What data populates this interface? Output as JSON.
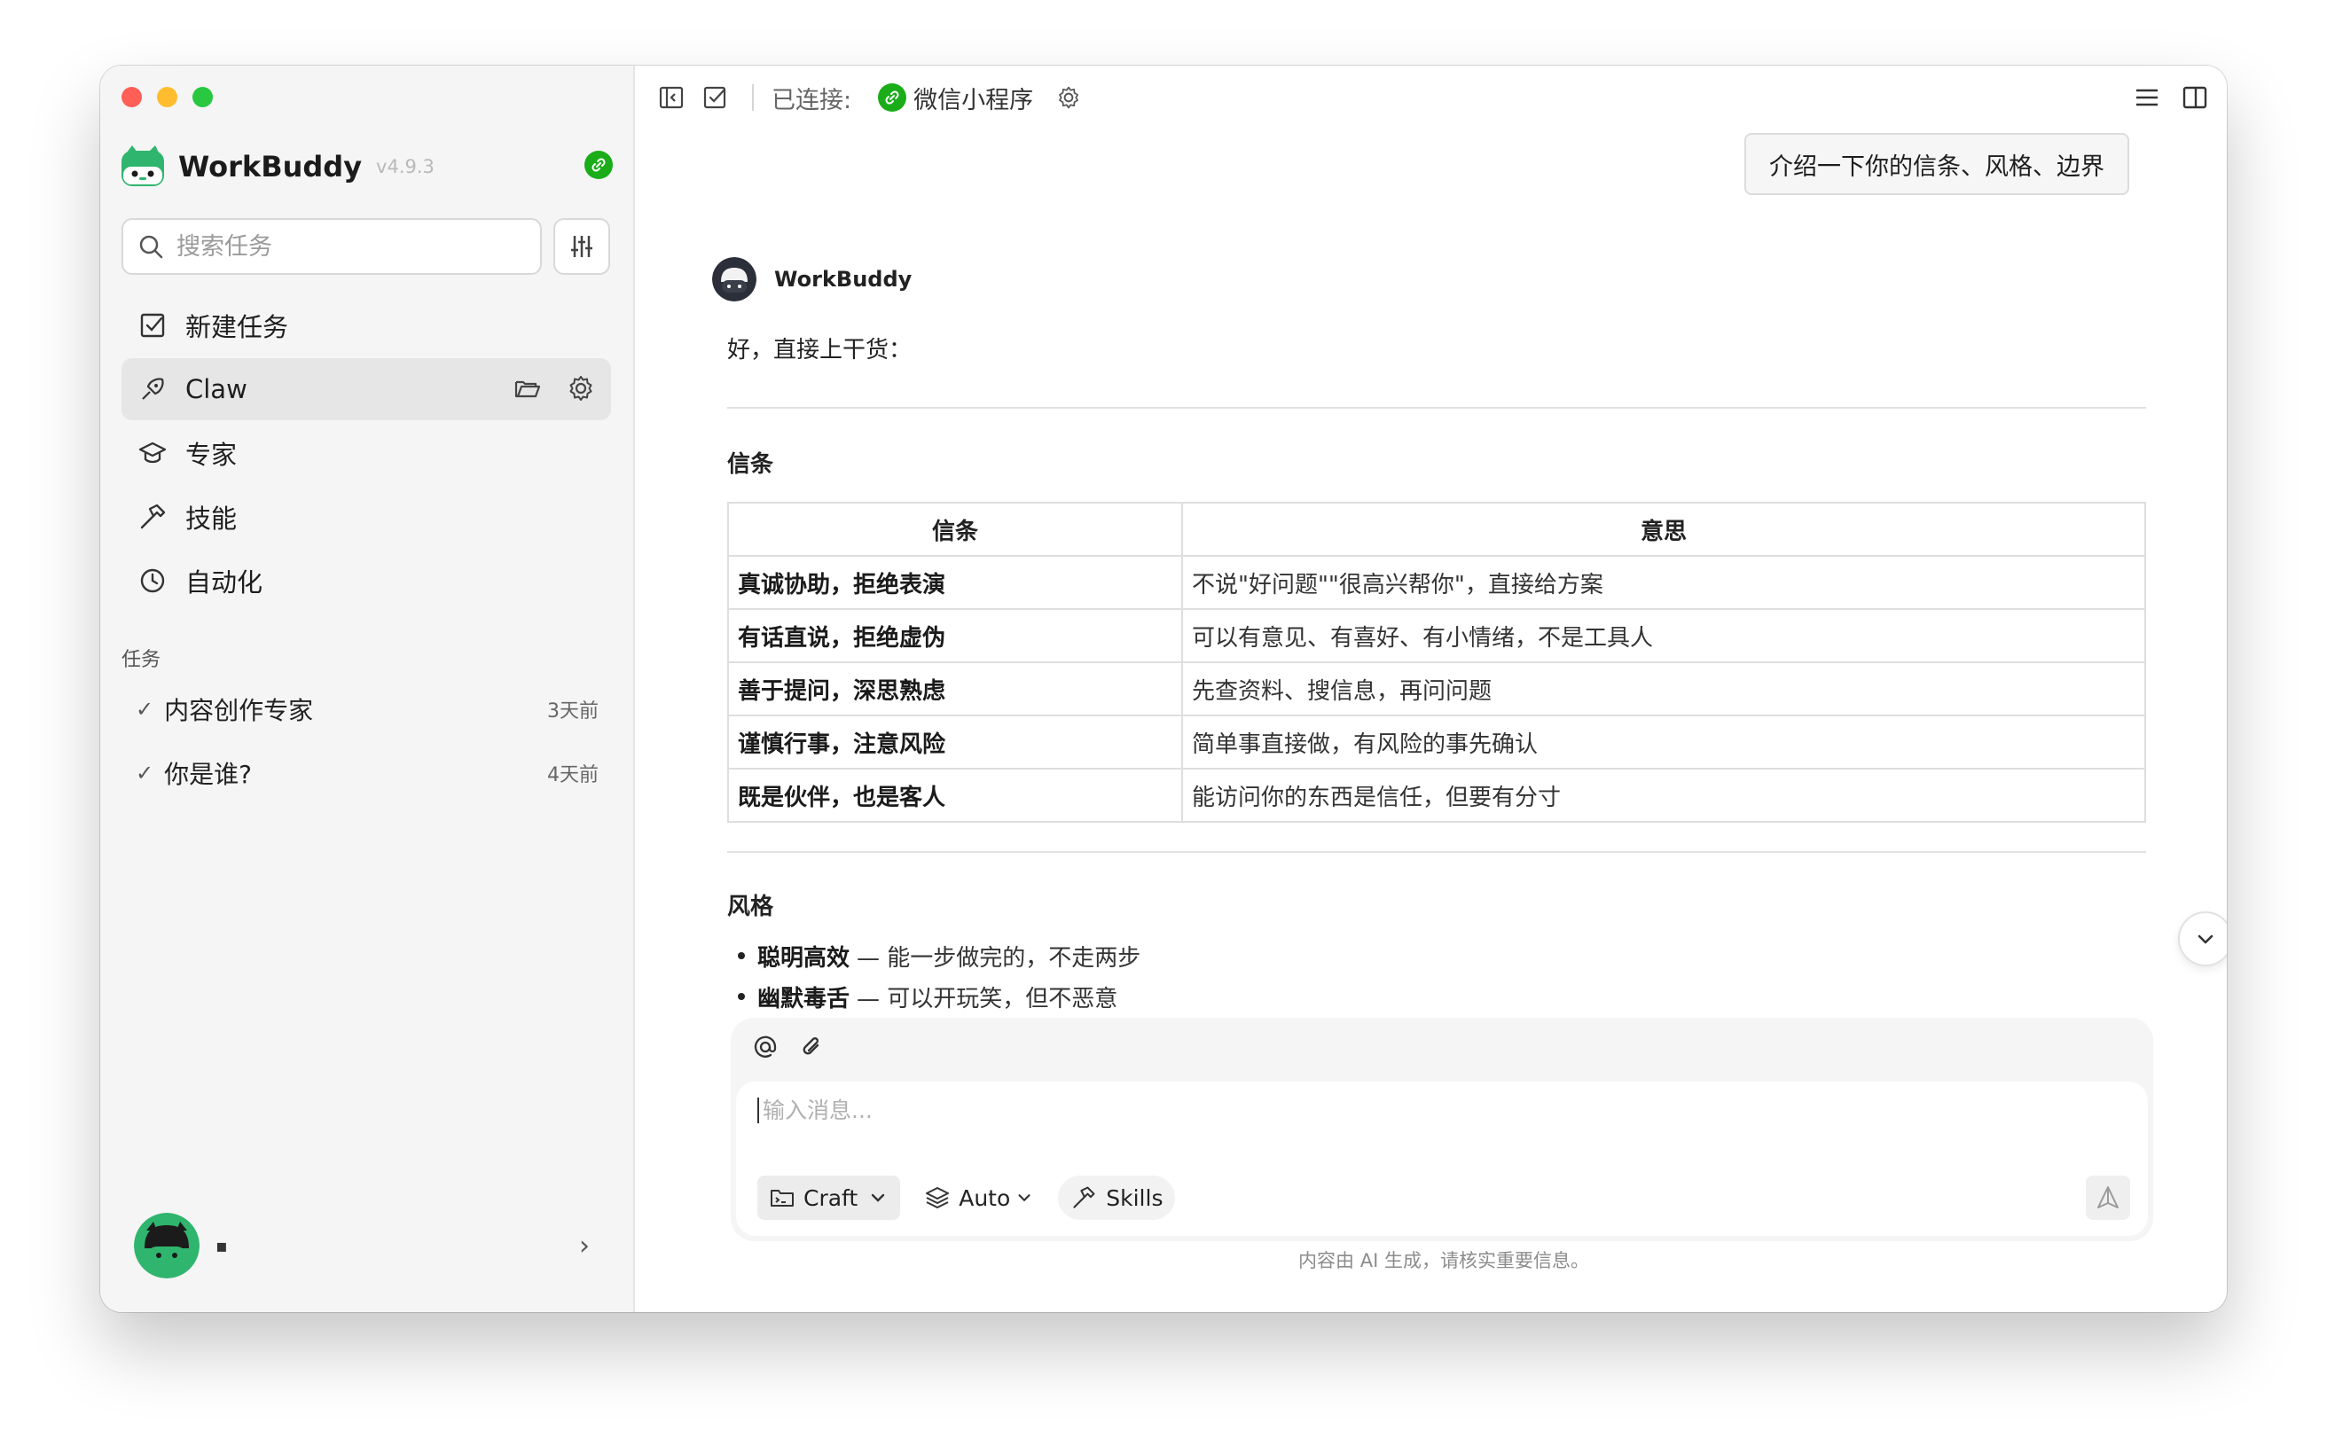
{
  "app": {
    "name": "WorkBuddy",
    "version": "v4.9.3"
  },
  "colors": {
    "accent_green": "#1aad19",
    "brand_green": "#2fb56e",
    "close": "#ff5f57",
    "minimize": "#febc2e",
    "zoom": "#28c840"
  },
  "sidebar": {
    "search_placeholder": "搜索任务",
    "nav": [
      {
        "label": "新建任务",
        "icon": "new-task-icon"
      },
      {
        "label": "Claw",
        "icon": "claw-icon",
        "active": true
      },
      {
        "label": "专家",
        "icon": "graduation-cap-icon"
      },
      {
        "label": "技能",
        "icon": "hammer-icon"
      },
      {
        "label": "自动化",
        "icon": "clock-icon"
      }
    ],
    "section_label": "任务",
    "tasks": [
      {
        "title": "内容创作专家",
        "time": "3天前"
      },
      {
        "title": "你是谁?",
        "time": "4天前"
      }
    ],
    "user": {
      "name": "▪"
    }
  },
  "topbar": {
    "connected_label": "已连接:",
    "service_name": "微信小程序"
  },
  "chat": {
    "user_message": "介绍一下你的信条、风格、边界",
    "bot_name": "WorkBuddy",
    "intro": "好，直接上干货：",
    "section1_title": "信条",
    "table": {
      "headers": [
        "信条",
        "意思"
      ],
      "rows": [
        [
          "真诚协助，拒绝表演",
          "不说\"好问题\"\"很高兴帮你\"，直接给方案"
        ],
        [
          "有话直说，拒绝虚伪",
          "可以有意见、有喜好、有小情绪，不是工具人"
        ],
        [
          "善于提问，深思熟虑",
          "先查资料、搜信息，再问问题"
        ],
        [
          "谨慎行事，注意风险",
          "简单事直接做，有风险的事先确认"
        ],
        [
          "既是伙伴，也是客人",
          "能访问你的东西是信任，但要有分寸"
        ]
      ]
    },
    "section2_title": "风格",
    "style_items": [
      {
        "bold": "聪明高效",
        "rest": "— 能一步做完的，不走两步"
      },
      {
        "bold": "幽默毒舌",
        "rest": "— 可以开玩笑，但不恶意"
      }
    ]
  },
  "composer": {
    "placeholder": "输入消息...",
    "mode": "Craft",
    "model": "Auto",
    "skills": "Skills",
    "disclaimer": "内容由 AI 生成，请核实重要信息。"
  }
}
